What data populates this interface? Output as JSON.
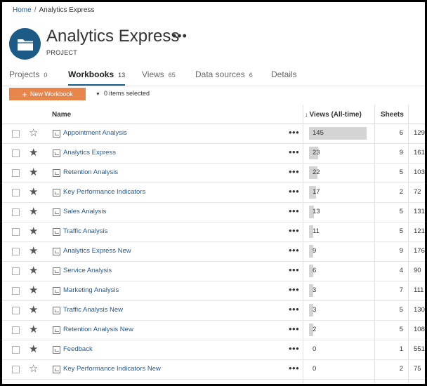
{
  "breadcrumb": {
    "home": "Home",
    "separator": "/",
    "current": "Analytics Express"
  },
  "project": {
    "title": "Analytics Express",
    "more": "•••",
    "subtitle": "PROJECT",
    "icon": "folder-icon",
    "icon_color": "#1d5b87"
  },
  "tabs": [
    {
      "label": "Projects",
      "count": "0"
    },
    {
      "label": "Workbooks",
      "count": "13"
    },
    {
      "label": "Views",
      "count": "65"
    },
    {
      "label": "Data sources",
      "count": "6"
    },
    {
      "label": "Details",
      "count": ""
    }
  ],
  "toolbar": {
    "new_workbook": "New Workbook",
    "accent": "#e8854b",
    "selection": "0 items selected"
  },
  "table": {
    "headers": {
      "name": "Name",
      "views": "Views (All-time)",
      "sheets": "Sheets"
    },
    "rows": [
      {
        "name": "Appointment Analysis",
        "favorite": false,
        "views": "145",
        "views_num": 145,
        "sheets": "6",
        "extra": "129"
      },
      {
        "name": "Analytics Express",
        "favorite": true,
        "views": "23",
        "views_num": 23,
        "sheets": "9",
        "extra": "161"
      },
      {
        "name": "Retention Analysis",
        "favorite": true,
        "views": "22",
        "views_num": 22,
        "sheets": "5",
        "extra": "103"
      },
      {
        "name": "Key Performance Indicators",
        "favorite": true,
        "views": "17",
        "views_num": 17,
        "sheets": "2",
        "extra": "72"
      },
      {
        "name": "Sales Analysis",
        "favorite": true,
        "views": "13",
        "views_num": 13,
        "sheets": "5",
        "extra": "131"
      },
      {
        "name": "Traffic Analysis",
        "favorite": true,
        "views": "11",
        "views_num": 11,
        "sheets": "5",
        "extra": "121"
      },
      {
        "name": "Analytics Express New",
        "favorite": true,
        "views": "9",
        "views_num": 9,
        "sheets": "9",
        "extra": "176"
      },
      {
        "name": "Service Analysis",
        "favorite": true,
        "views": "6",
        "views_num": 6,
        "sheets": "4",
        "extra": "90"
      },
      {
        "name": "Marketing Analysis",
        "favorite": true,
        "views": "3",
        "views_num": 3,
        "sheets": "7",
        "extra": "111"
      },
      {
        "name": "Traffic Analysis New",
        "favorite": true,
        "views": "3",
        "views_num": 3,
        "sheets": "5",
        "extra": "130"
      },
      {
        "name": "Retention Analysis New",
        "favorite": true,
        "views": "2",
        "views_num": 2,
        "sheets": "5",
        "extra": "108"
      },
      {
        "name": "Feedback",
        "favorite": true,
        "views": "0",
        "views_num": 0,
        "sheets": "1",
        "extra": "551"
      },
      {
        "name": "Key Performance Indicators New",
        "favorite": false,
        "views": "0",
        "views_num": 0,
        "sheets": "2",
        "extra": "75"
      }
    ]
  }
}
